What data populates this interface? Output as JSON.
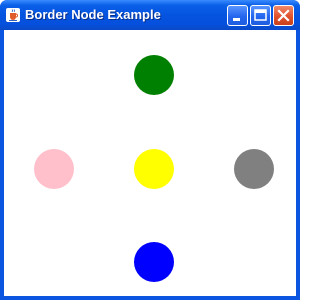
{
  "window": {
    "title": "Border Node Example",
    "icon": "java-cup-icon"
  },
  "titlebar_buttons": {
    "minimize": "minimize-icon",
    "maximize": "maximize-icon",
    "close": "close-icon"
  },
  "nodes": {
    "north": {
      "color": "#008000"
    },
    "west": {
      "color": "#ffc0cb"
    },
    "center": {
      "color": "#ffff00"
    },
    "east": {
      "color": "#808080"
    },
    "south": {
      "color": "#0000ff"
    }
  }
}
